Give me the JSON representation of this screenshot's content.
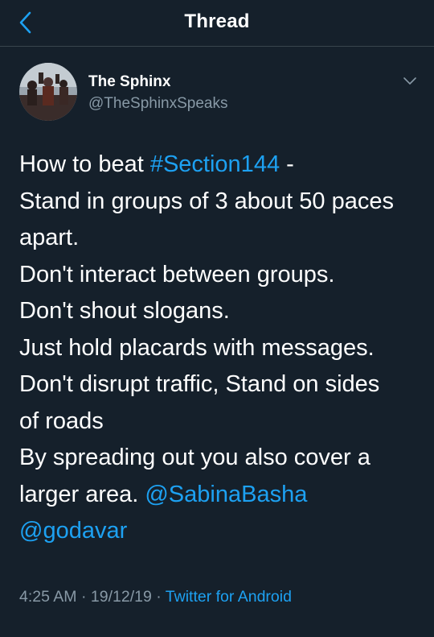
{
  "header": {
    "title": "Thread"
  },
  "author": {
    "display_name": "The Sphinx",
    "handle": "@TheSphinxSpeaks"
  },
  "tweet": {
    "line1_prefix": "How to beat ",
    "hashtag": "#Section144",
    "line1_suffix": " -",
    "line2": "Stand in groups of 3 about 50 paces",
    "line3": "apart.",
    "line4": "Don't interact between groups.",
    "line5": "Don't shout slogans.",
    "line6": "Just hold placards with messages.",
    "line7": "Don't disrupt traffic, Stand on sides",
    "line8": "of roads",
    "line9": "By spreading out you also cover a",
    "line10_prefix": "larger area. ",
    "mention1": "@SabinaBasha",
    "mention2": "@godavar"
  },
  "meta": {
    "time": "4:25 AM",
    "separator": " · ",
    "date": "19/12/19",
    "source": "Twitter for Android"
  },
  "colors": {
    "background": "#15202b",
    "accent": "#1da1f2",
    "secondary_text": "#8899a6"
  },
  "icons": {
    "back": "chevron-left-icon",
    "menu": "chevron-down-icon"
  }
}
